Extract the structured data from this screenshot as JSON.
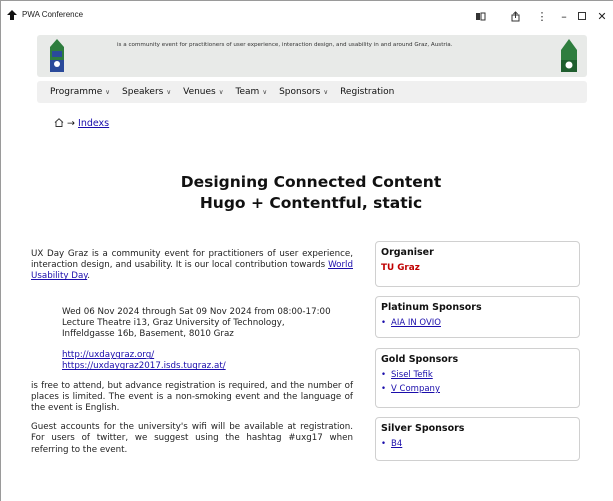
{
  "window": {
    "title": "PWA Conference"
  },
  "banner": {
    "tagline": "is a community event for practitioners of user experience, interaction design, and usability in and around Graz, Austria."
  },
  "nav": {
    "items": [
      {
        "label": "Programme",
        "dropdown": true
      },
      {
        "label": "Speakers",
        "dropdown": true
      },
      {
        "label": "Venues",
        "dropdown": true
      },
      {
        "label": "Team",
        "dropdown": true
      },
      {
        "label": "Sponsors",
        "dropdown": true
      },
      {
        "label": "Registration",
        "dropdown": false
      }
    ]
  },
  "breadcrumb": {
    "arrow": "→",
    "link": "Indexs"
  },
  "page": {
    "title_line1": "Designing Connected Content",
    "title_line2": "Hugo + Contentful, static"
  },
  "main": {
    "intro": "UX Day Graz is a community event for practitioners of user experience, interaction design, and usability. It is our local contribution towards",
    "intro_link": "World Usability Day",
    "intro_end": ".",
    "when": "Wed 06 Nov 2024 through Sat 09 Nov 2024 from 08:00-17:00",
    "where_line1": "Lecture Theatre i13, Graz University of Technology,",
    "where_line2": "Inffeldgasse 16b, Basement, 8010 Graz",
    "link1": "http://uxdaygraz.org/",
    "link2": "https://uxdaygraz2017.isds.tugraz.at/",
    "para2": "is free to attend, but advance registration is required, and the number of places is limited. The event is a non-smoking event and the language of the event is English.",
    "para3": "Guest accounts for the university's wifi will be available at registration. For users of twitter, we suggest using the hashtag #uxg17 when referring to the event."
  },
  "sidebar": {
    "organiser": {
      "heading": "Organiser",
      "name": "TU Graz"
    },
    "platinum": {
      "heading": "Platinum Sponsors",
      "items": [
        "AIA IN OVIO"
      ]
    },
    "gold": {
      "heading": "Gold Sponsors",
      "items": [
        "Sisel Tefik",
        "V Company"
      ]
    },
    "silver": {
      "heading": "Silver Sponsors",
      "items": [
        "B4"
      ]
    }
  },
  "colors": {
    "accent": "#1a0dab",
    "organiser": "#c00000",
    "logo_green": "#2e7d3e"
  }
}
